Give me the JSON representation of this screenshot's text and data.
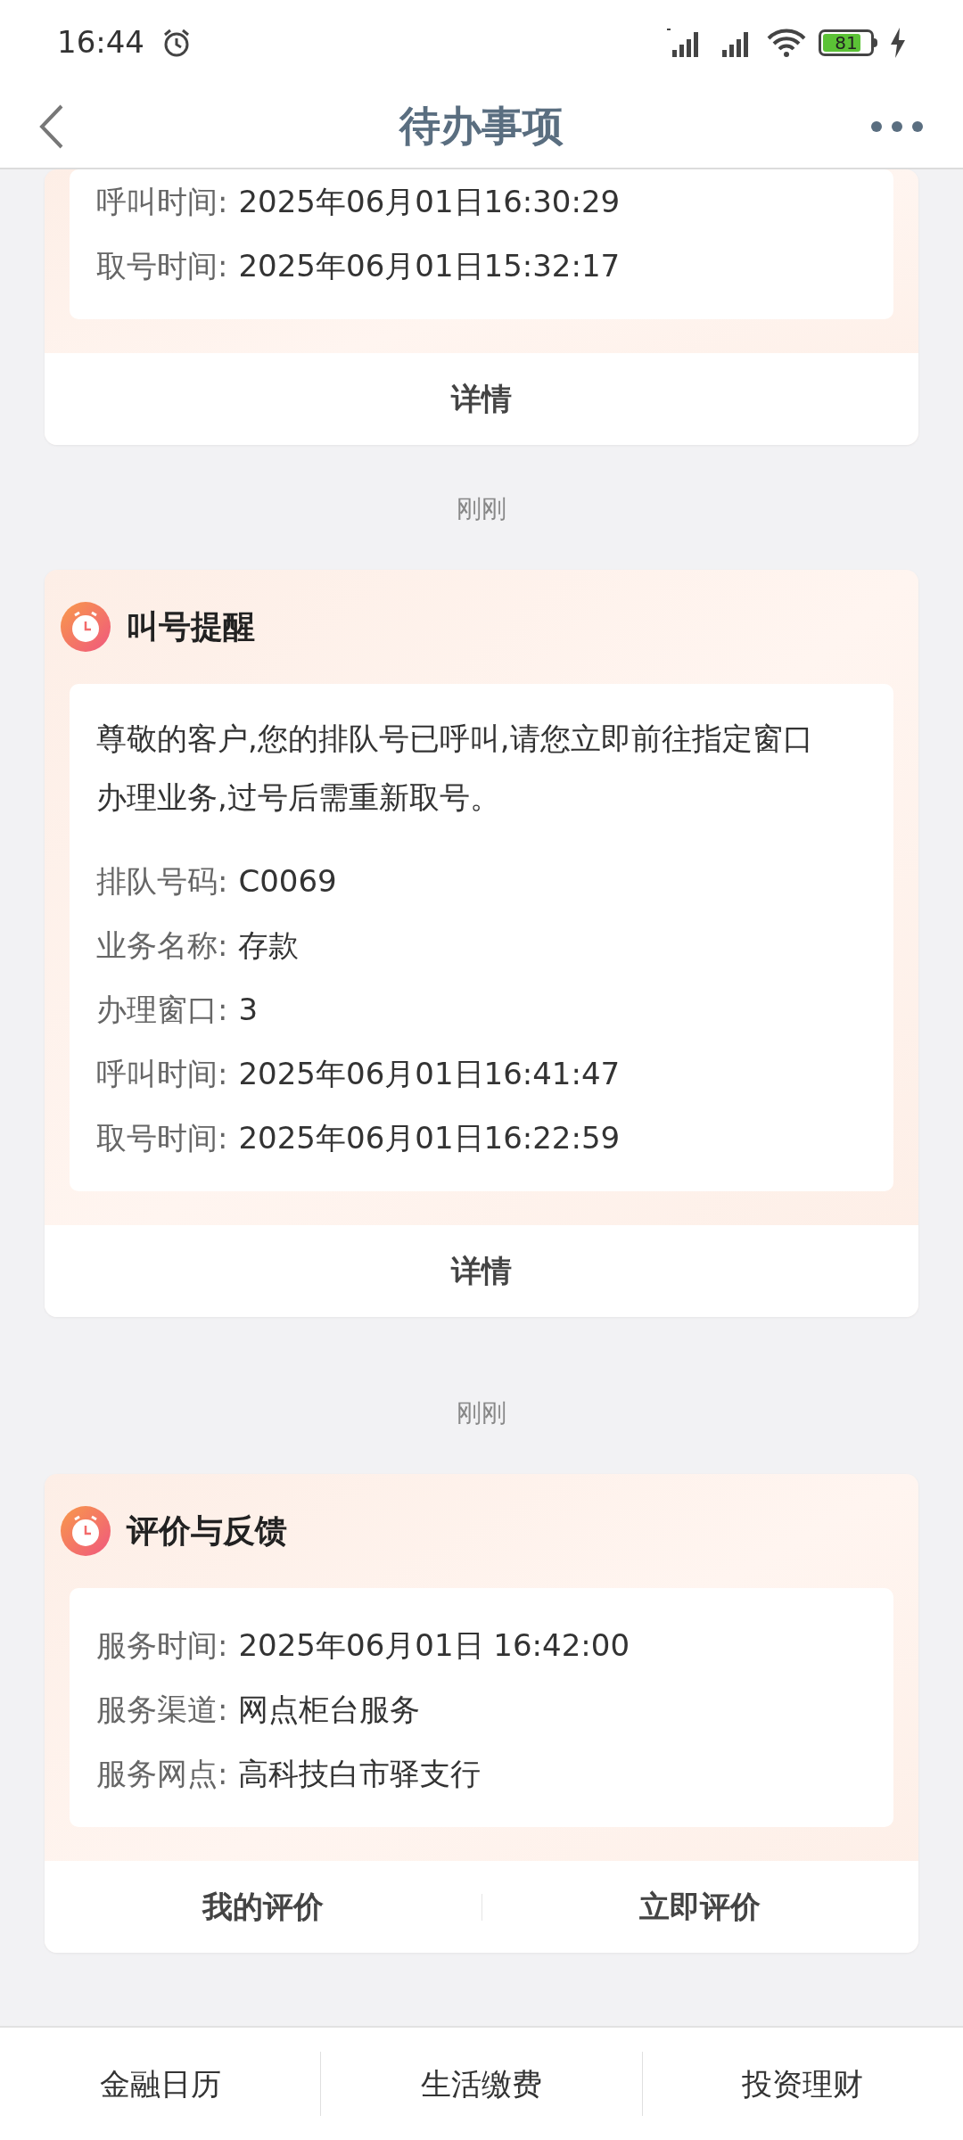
{
  "status_bar": {
    "time": "16:44",
    "battery": "81"
  },
  "header": {
    "title": "待办事项"
  },
  "cards": [
    {
      "fields": [
        {
          "label": "呼叫时间:",
          "value": "2025年06月01日16:30:29"
        },
        {
          "label": "取号时间:",
          "value": "2025年06月01日15:32:17"
        }
      ],
      "buttons": [
        "详情"
      ]
    },
    {
      "time": "刚刚",
      "title": "叫号提醒",
      "message": "尊敬的客户,您的排队号已呼叫,请您立即前往指定窗口办理业务,过号后需重新取号。",
      "fields": [
        {
          "label": "排队号码:",
          "value": "C0069"
        },
        {
          "label": "业务名称:",
          "value": "存款"
        },
        {
          "label": "办理窗口:",
          "value": "3"
        },
        {
          "label": "呼叫时间:",
          "value": "2025年06月01日16:41:47"
        },
        {
          "label": "取号时间:",
          "value": "2025年06月01日16:22:59"
        }
      ],
      "buttons": [
        "详情"
      ]
    },
    {
      "time": "刚刚",
      "title": "评价与反馈",
      "fields": [
        {
          "label": "服务时间:",
          "value": "2025年06月01日 16:42:00"
        },
        {
          "label": "服务渠道:",
          "value": "网点柜台服务"
        },
        {
          "label": "服务网点:",
          "value": "高科技白市驿支行"
        }
      ],
      "buttons": [
        "我的评价",
        "立即评价"
      ]
    }
  ],
  "bottom_nav": [
    "金融日历",
    "生活缴费",
    "投资理财"
  ]
}
